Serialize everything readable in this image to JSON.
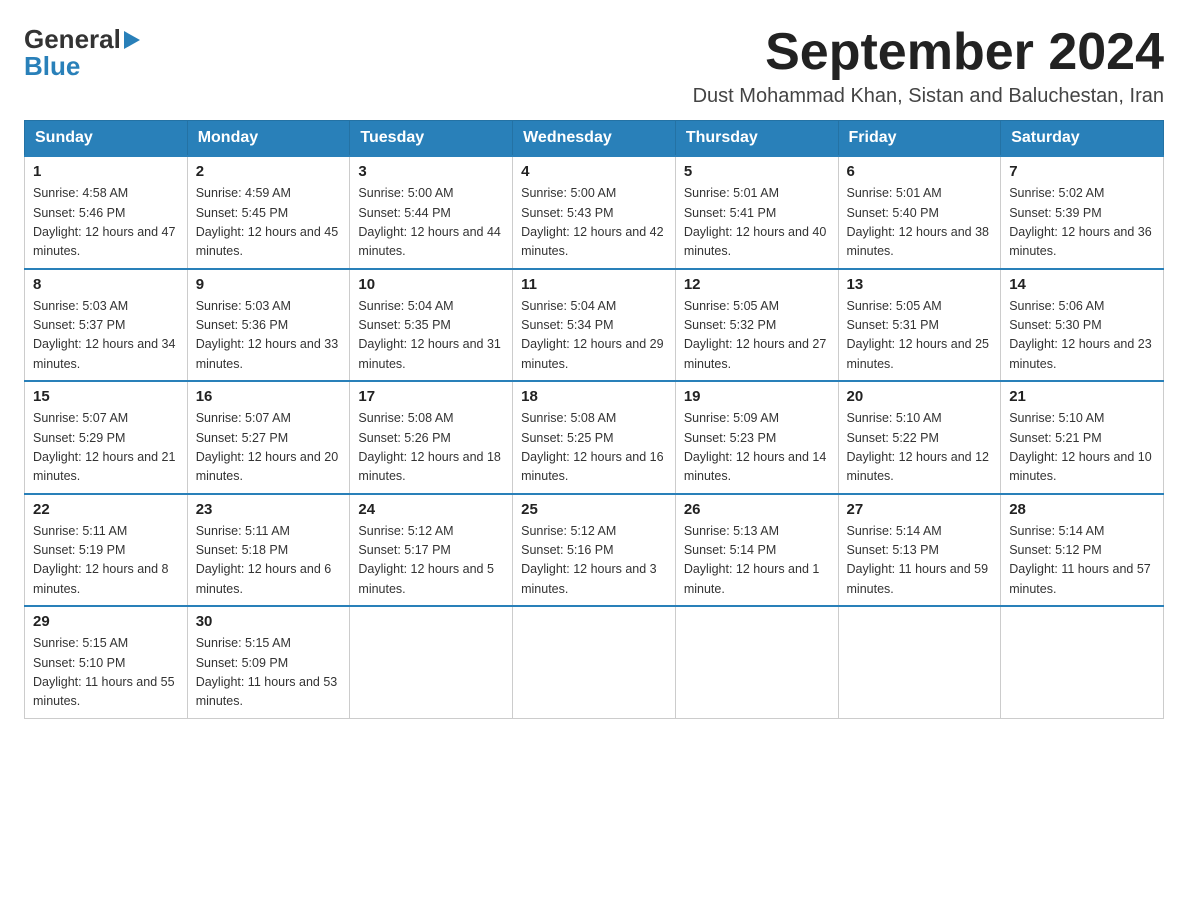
{
  "header": {
    "logo_general": "General",
    "logo_blue": "Blue",
    "title": "September 2024",
    "subtitle": "Dust Mohammad Khan, Sistan and Baluchestan, Iran"
  },
  "days_of_week": [
    "Sunday",
    "Monday",
    "Tuesday",
    "Wednesday",
    "Thursday",
    "Friday",
    "Saturday"
  ],
  "weeks": [
    [
      {
        "day": "1",
        "sunrise": "4:58 AM",
        "sunset": "5:46 PM",
        "daylight": "12 hours and 47 minutes."
      },
      {
        "day": "2",
        "sunrise": "4:59 AM",
        "sunset": "5:45 PM",
        "daylight": "12 hours and 45 minutes."
      },
      {
        "day": "3",
        "sunrise": "5:00 AM",
        "sunset": "5:44 PM",
        "daylight": "12 hours and 44 minutes."
      },
      {
        "day": "4",
        "sunrise": "5:00 AM",
        "sunset": "5:43 PM",
        "daylight": "12 hours and 42 minutes."
      },
      {
        "day": "5",
        "sunrise": "5:01 AM",
        "sunset": "5:41 PM",
        "daylight": "12 hours and 40 minutes."
      },
      {
        "day": "6",
        "sunrise": "5:01 AM",
        "sunset": "5:40 PM",
        "daylight": "12 hours and 38 minutes."
      },
      {
        "day": "7",
        "sunrise": "5:02 AM",
        "sunset": "5:39 PM",
        "daylight": "12 hours and 36 minutes."
      }
    ],
    [
      {
        "day": "8",
        "sunrise": "5:03 AM",
        "sunset": "5:37 PM",
        "daylight": "12 hours and 34 minutes."
      },
      {
        "day": "9",
        "sunrise": "5:03 AM",
        "sunset": "5:36 PM",
        "daylight": "12 hours and 33 minutes."
      },
      {
        "day": "10",
        "sunrise": "5:04 AM",
        "sunset": "5:35 PM",
        "daylight": "12 hours and 31 minutes."
      },
      {
        "day": "11",
        "sunrise": "5:04 AM",
        "sunset": "5:34 PM",
        "daylight": "12 hours and 29 minutes."
      },
      {
        "day": "12",
        "sunrise": "5:05 AM",
        "sunset": "5:32 PM",
        "daylight": "12 hours and 27 minutes."
      },
      {
        "day": "13",
        "sunrise": "5:05 AM",
        "sunset": "5:31 PM",
        "daylight": "12 hours and 25 minutes."
      },
      {
        "day": "14",
        "sunrise": "5:06 AM",
        "sunset": "5:30 PM",
        "daylight": "12 hours and 23 minutes."
      }
    ],
    [
      {
        "day": "15",
        "sunrise": "5:07 AM",
        "sunset": "5:29 PM",
        "daylight": "12 hours and 21 minutes."
      },
      {
        "day": "16",
        "sunrise": "5:07 AM",
        "sunset": "5:27 PM",
        "daylight": "12 hours and 20 minutes."
      },
      {
        "day": "17",
        "sunrise": "5:08 AM",
        "sunset": "5:26 PM",
        "daylight": "12 hours and 18 minutes."
      },
      {
        "day": "18",
        "sunrise": "5:08 AM",
        "sunset": "5:25 PM",
        "daylight": "12 hours and 16 minutes."
      },
      {
        "day": "19",
        "sunrise": "5:09 AM",
        "sunset": "5:23 PM",
        "daylight": "12 hours and 14 minutes."
      },
      {
        "day": "20",
        "sunrise": "5:10 AM",
        "sunset": "5:22 PM",
        "daylight": "12 hours and 12 minutes."
      },
      {
        "day": "21",
        "sunrise": "5:10 AM",
        "sunset": "5:21 PM",
        "daylight": "12 hours and 10 minutes."
      }
    ],
    [
      {
        "day": "22",
        "sunrise": "5:11 AM",
        "sunset": "5:19 PM",
        "daylight": "12 hours and 8 minutes."
      },
      {
        "day": "23",
        "sunrise": "5:11 AM",
        "sunset": "5:18 PM",
        "daylight": "12 hours and 6 minutes."
      },
      {
        "day": "24",
        "sunrise": "5:12 AM",
        "sunset": "5:17 PM",
        "daylight": "12 hours and 5 minutes."
      },
      {
        "day": "25",
        "sunrise": "5:12 AM",
        "sunset": "5:16 PM",
        "daylight": "12 hours and 3 minutes."
      },
      {
        "day": "26",
        "sunrise": "5:13 AM",
        "sunset": "5:14 PM",
        "daylight": "12 hours and 1 minute."
      },
      {
        "day": "27",
        "sunrise": "5:14 AM",
        "sunset": "5:13 PM",
        "daylight": "11 hours and 59 minutes."
      },
      {
        "day": "28",
        "sunrise": "5:14 AM",
        "sunset": "5:12 PM",
        "daylight": "11 hours and 57 minutes."
      }
    ],
    [
      {
        "day": "29",
        "sunrise": "5:15 AM",
        "sunset": "5:10 PM",
        "daylight": "11 hours and 55 minutes."
      },
      {
        "day": "30",
        "sunrise": "5:15 AM",
        "sunset": "5:09 PM",
        "daylight": "11 hours and 53 minutes."
      },
      null,
      null,
      null,
      null,
      null
    ]
  ]
}
